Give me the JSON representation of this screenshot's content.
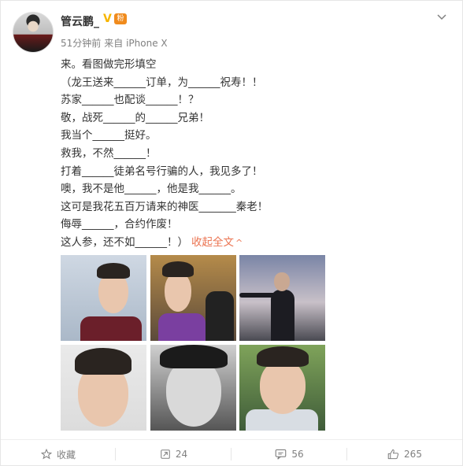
{
  "post": {
    "author": "管云鹏_",
    "verified_mark": "V",
    "fan_badge": "粉",
    "time": "51分钟前",
    "source": "来自 iPhone X",
    "lines": [
      "来。看图做完形填空",
      "（龙王送来______订单，为______祝寿！！",
      "苏家______也配谈______！？",
      "敬，战死______的______兄弟！",
      "我当个______挺好。",
      "救我，不然______！",
      "打着______徒弟名号行骗的人，我见多了！",
      "噢，我不是他______，他是我______。",
      "这可是我花五百万请来的神医_______秦老！",
      "侮辱______，合约作废！"
    ],
    "last_line": "这人参，还不如______！）",
    "collapse_label": "收起全文",
    "collapse_arrow": "^"
  },
  "actions": {
    "favorite_label": "收藏",
    "repost_count": "24",
    "comment_count": "56",
    "like_count": "265"
  }
}
